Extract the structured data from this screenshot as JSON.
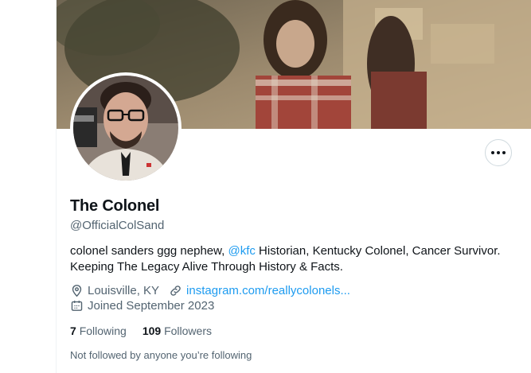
{
  "profile": {
    "display_name": "The Colonel",
    "handle": "@OfficialColSand",
    "bio": {
      "before_mention": "colonel sanders ggg nephew, ",
      "mention": "@kfc",
      "after_mention": " Historian, Kentucky Colonel, Cancer Survivor. Keeping The Legacy Alive Through History & Facts."
    },
    "location": "Louisville, KY",
    "website": "instagram.com/reallycolonels...",
    "joined": "Joined September 2023",
    "following_count": "7",
    "following_label": "Following",
    "followers_count": "109",
    "followers_label": "Followers",
    "not_followed_text": "Not followed by anyone you’re following"
  },
  "icons": {
    "more": "more-horizontal-icon",
    "location": "location-pin-icon",
    "link": "link-icon",
    "calendar": "calendar-icon"
  },
  "colors": {
    "accent": "#1d9bf0",
    "secondary_text": "#536471",
    "primary_text": "#0f1419",
    "border": "#cfd9de"
  }
}
